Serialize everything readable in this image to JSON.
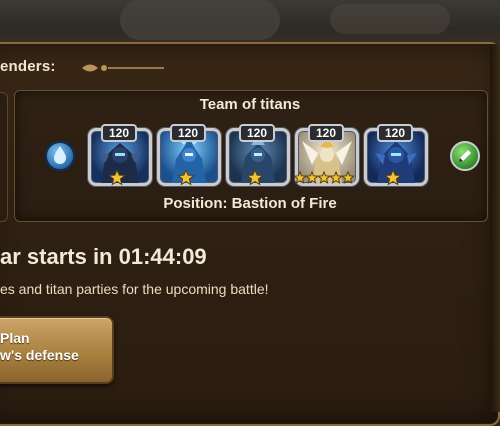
{
  "header": {
    "defenders_label": "enders:"
  },
  "team": {
    "title": "Team of titans",
    "position_text": "Position: Bastion of Fire",
    "element_icon": "water-drop-icon",
    "edit_icon": "pencil-icon",
    "titans": [
      {
        "level": "120",
        "stars": 1,
        "star_color": "#f0c23a",
        "portrait": "dark-blue-armored-titan"
      },
      {
        "level": "120",
        "stars": 1,
        "star_color": "#f0c23a",
        "portrait": "blue-flame-titan"
      },
      {
        "level": "120",
        "stars": 1,
        "star_color": "#f0c23a",
        "portrait": "blue-stone-titan"
      },
      {
        "level": "120",
        "stars": 5,
        "star_color": "#f0c23a",
        "portrait": "golden-winged-titan"
      },
      {
        "level": "120",
        "stars": 1,
        "star_color": "#f0c23a",
        "portrait": "blue-armored-titan"
      }
    ]
  },
  "war": {
    "timer_text": "ar starts in 01:44:09",
    "description": "es and titan parties for the upcoming battle!"
  },
  "plan_button": {
    "line1": "Plan",
    "line2": "w's defense"
  },
  "colors": {
    "panel": "#2e2012",
    "border": "#8a6a3a",
    "text": "#f3ead6",
    "button": "#a9803f",
    "edit_green": "#3fae2e",
    "water_blue": "#3a8fd8"
  }
}
